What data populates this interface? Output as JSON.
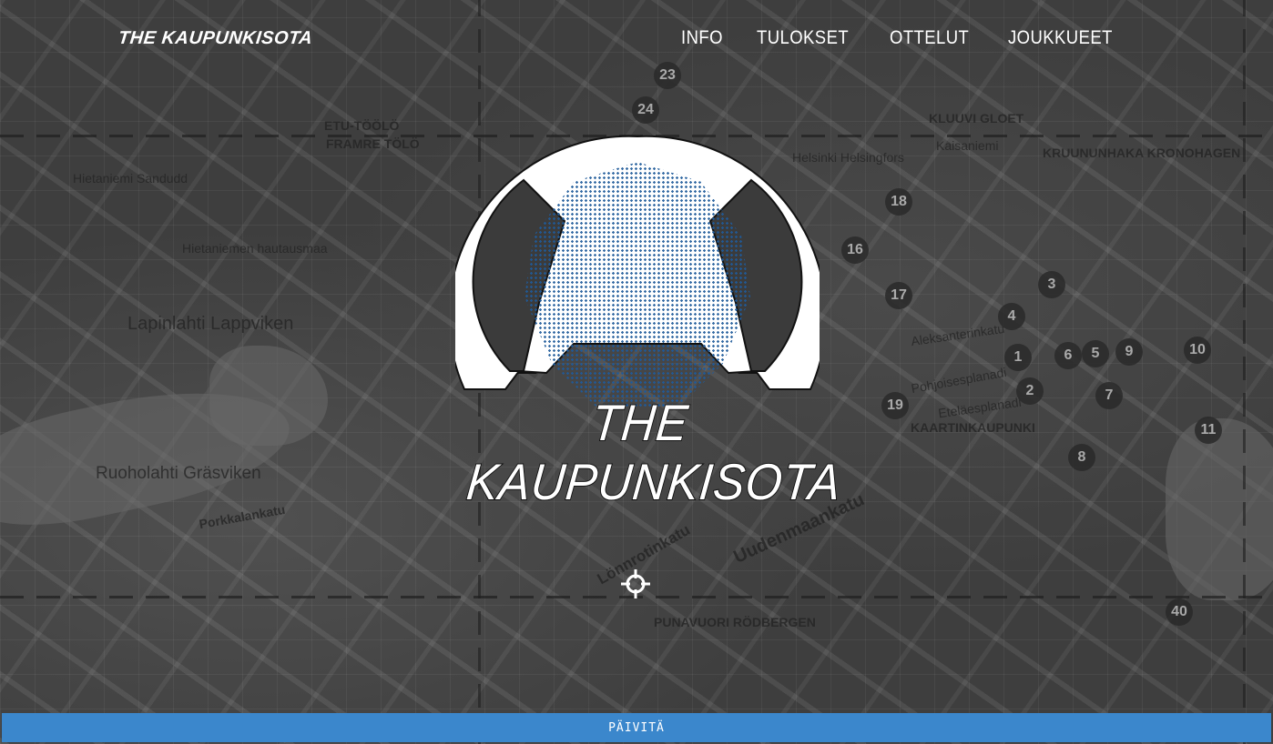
{
  "header": {
    "brand": "THE KAUPUNKISOTA",
    "nav": [
      {
        "label": "INFO"
      },
      {
        "label": "TULOKSET"
      },
      {
        "label": "OTTELUT"
      },
      {
        "label": "JOUKKUEET"
      }
    ]
  },
  "hero": {
    "title": "THE KAUPUNKISOTA",
    "emblem_icon": "overwatch-style-emblem-icon"
  },
  "map": {
    "labels": [
      "ETU-TÖÖLÖ",
      "FRAMRE TÖLÖ",
      "Hietaniemi Sandudd",
      "Hietaniemen hautausmaa",
      "Lapinlahti Lappviken",
      "Ruoholahti Gräsviken",
      "Porkkalankatu",
      "KRUUNUNHAKA KRONOHAGEN",
      "KLUUVI GLOET",
      "Helsinki Helsingfors",
      "KAARTINKAUPUNKI",
      "PUNAVUORI RÖDBERGEN",
      "Lönnrotinkatu",
      "Uudenmaankatu",
      "Pohjoisesplanadi",
      "Eteläesplanadi",
      "Aleksanterinkatu",
      "Kaisaniemi"
    ],
    "markers": [
      "23",
      "24",
      "18",
      "16",
      "17",
      "3",
      "4",
      "1",
      "6",
      "5",
      "9",
      "10",
      "2",
      "7",
      "19",
      "11",
      "8",
      "40"
    ]
  },
  "crosshair_icon": "crosshair-icon",
  "refresh": {
    "label": "PÄIVITÄ"
  },
  "colors": {
    "refresh_bar": "#3b87cc",
    "emblem_fill": "#ffffff",
    "ascii_art": "#1f5a9a"
  }
}
